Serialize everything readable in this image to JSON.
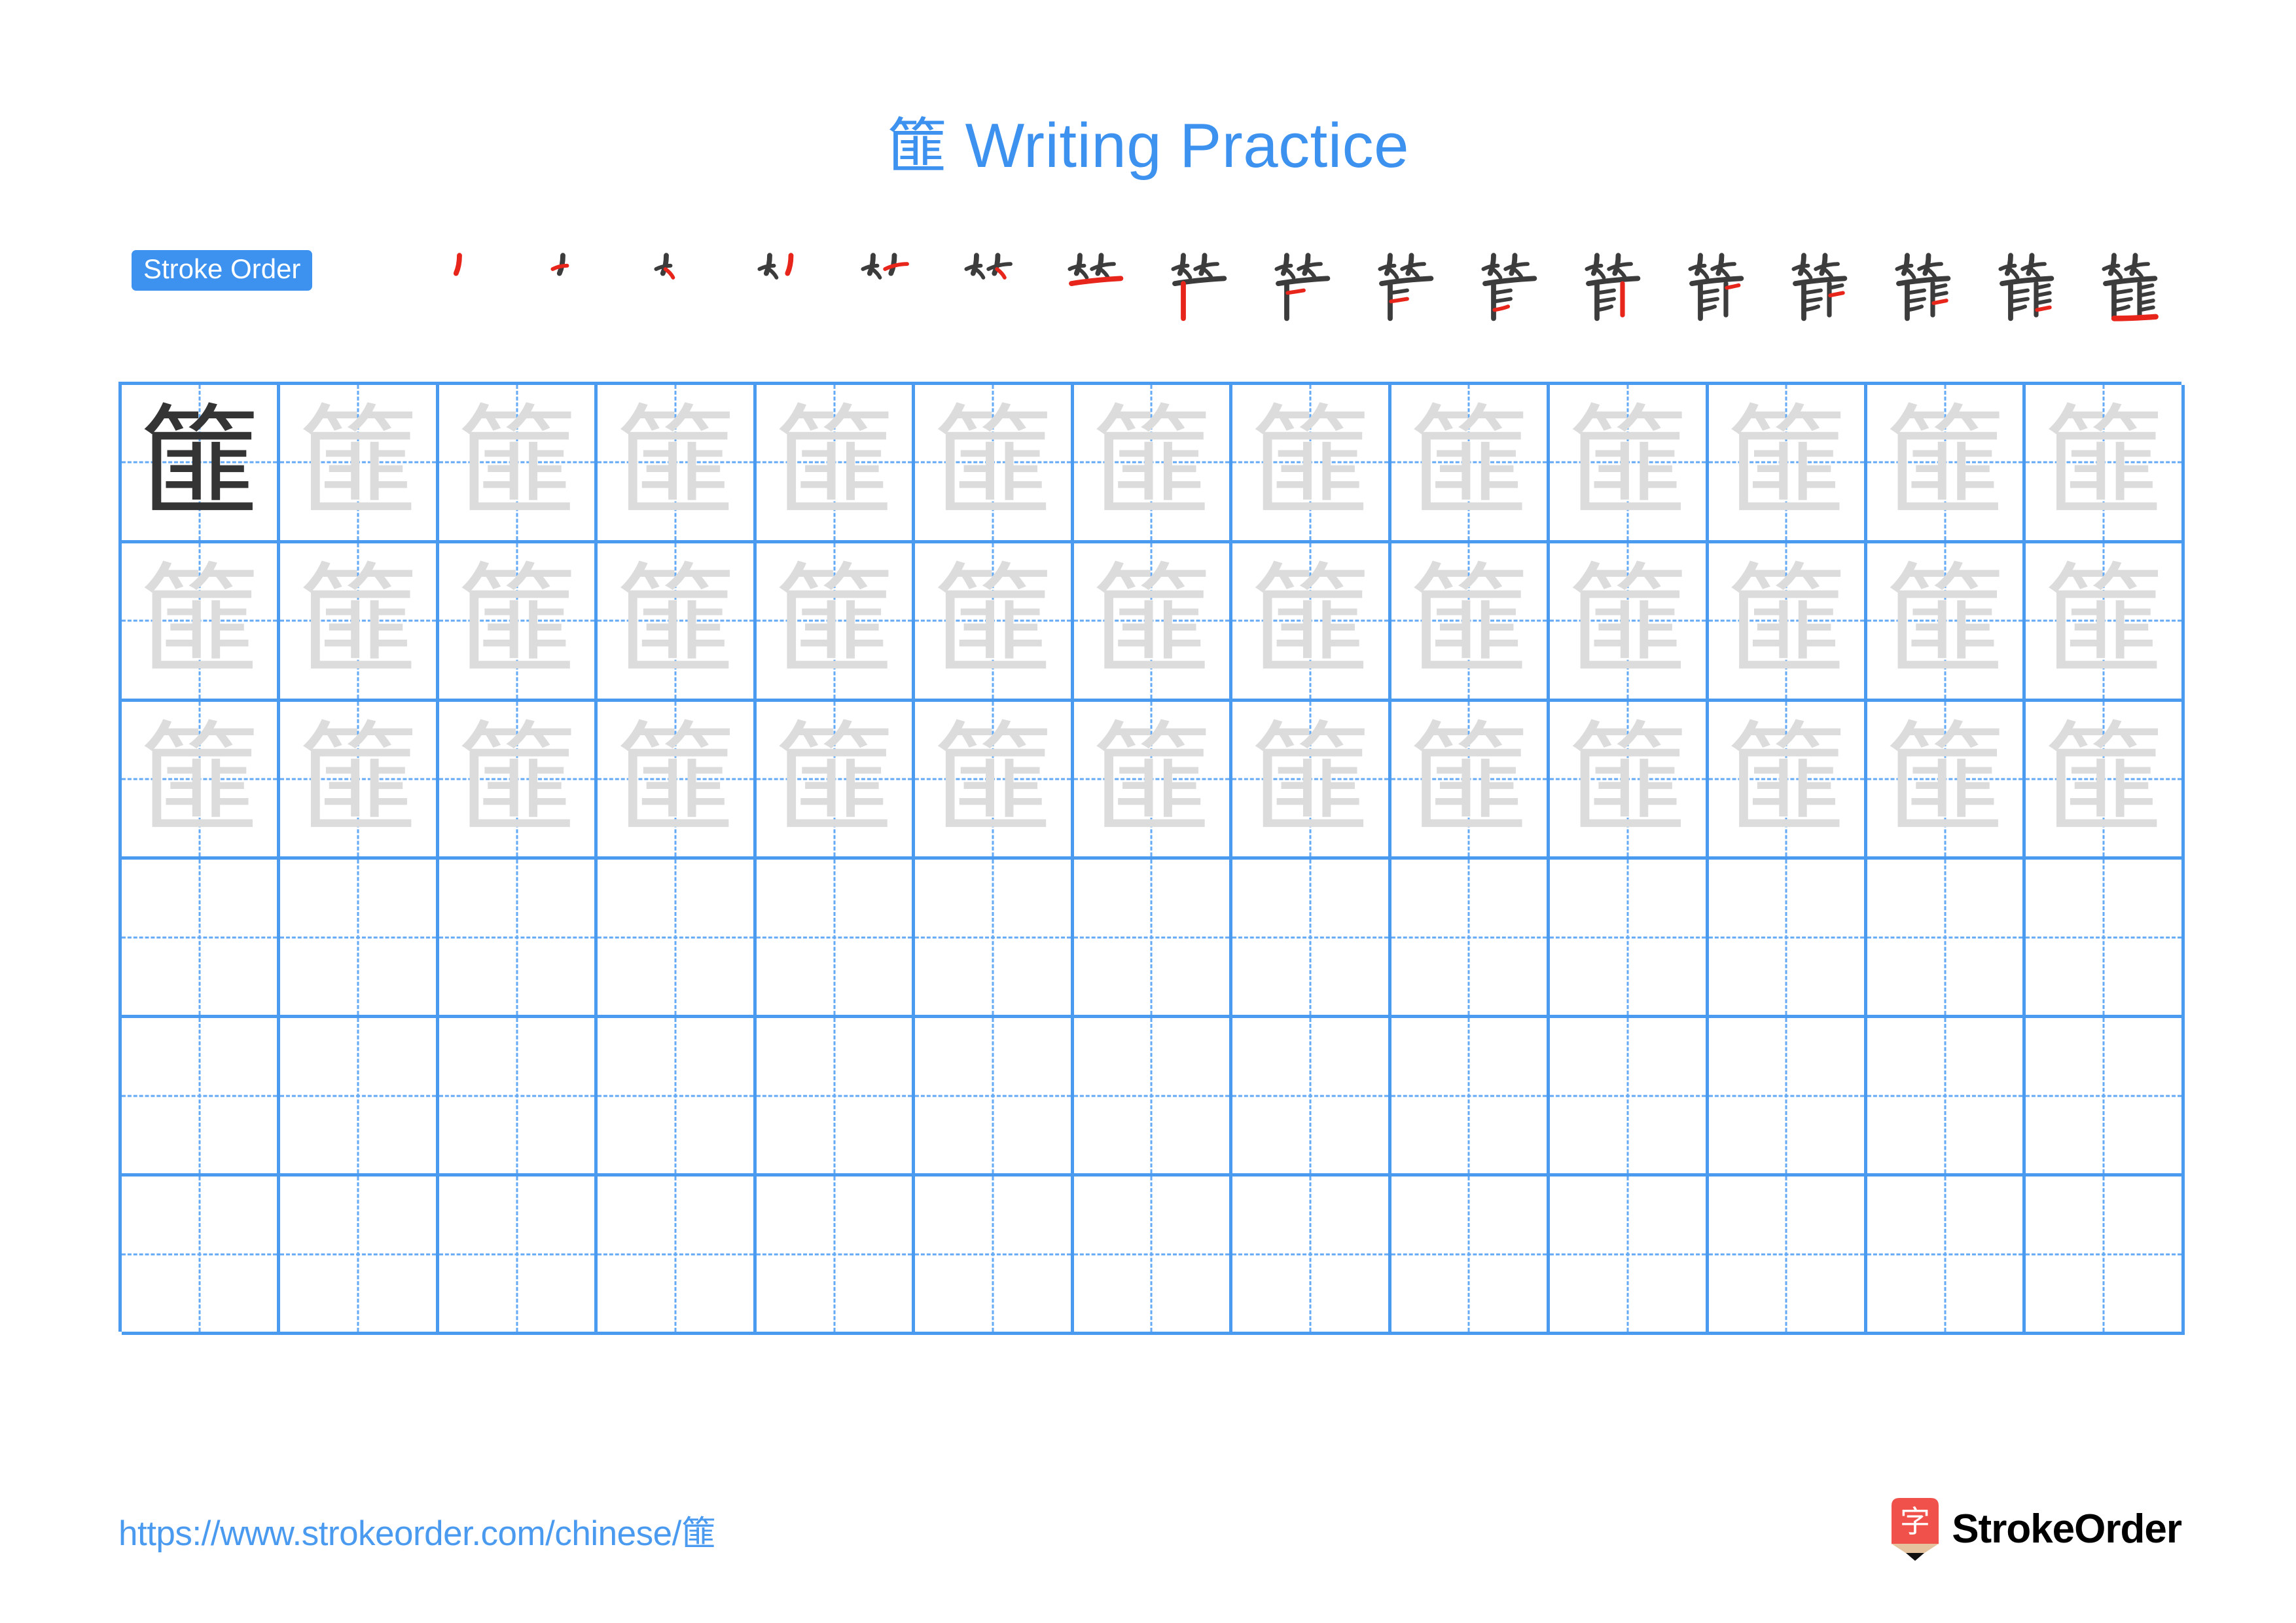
{
  "title": {
    "character": "篚",
    "text": " Writing Practice",
    "color": "#3d92f0"
  },
  "stroke_order": {
    "badge_label": "Stroke Order",
    "badge_bg": "#3d92f0",
    "badge_text_color": "#ffffff",
    "total_strokes": 17,
    "new_stroke_color": "#e8251b",
    "existing_stroke_color": "#3c3c3c",
    "steps": [
      {
        "index": 1,
        "new_stroke": "丿 (left downward)"
      },
      {
        "index": 2,
        "new_stroke": "一 (short horizontal)"
      },
      {
        "index": 3,
        "new_stroke": "丶 (short right dot)"
      },
      {
        "index": 4,
        "new_stroke": "丿 (second left downward)"
      },
      {
        "index": 5,
        "new_stroke": "一 (second short horizontal)"
      },
      {
        "index": 6,
        "new_stroke": "丶 (second short right dot)"
      },
      {
        "index": 7,
        "new_stroke": "一 (horizontal of 匚 top)"
      },
      {
        "index": 8,
        "new_stroke": "丨 (long vertical)"
      },
      {
        "index": 9,
        "new_stroke": "一 (first inner horizontal)"
      },
      {
        "index": 10,
        "new_stroke": "一 (second inner horizontal)"
      },
      {
        "index": 11,
        "new_stroke": "㇀ (rising stroke)"
      },
      {
        "index": 12,
        "new_stroke": "丨 (right vertical)"
      },
      {
        "index": 13,
        "new_stroke": "一 (right first horizontal)"
      },
      {
        "index": 14,
        "new_stroke": "一 (right second horizontal)"
      },
      {
        "index": 15,
        "new_stroke": "一 (right third horizontal)"
      },
      {
        "index": 16,
        "new_stroke": "一 (right fourth horizontal)"
      },
      {
        "index": 17,
        "new_stroke": "乚 (enclosing bottom hook)"
      }
    ]
  },
  "grid": {
    "columns": 13,
    "rows": 6,
    "border_color": "#4a9af0",
    "guide_color": "#64aaf5",
    "model_char_color": "#343434",
    "trace_char_color": "#dcdcdc",
    "character": "篚",
    "rows_data": [
      {
        "row": 1,
        "model_first": true,
        "filled_cells": 13
      },
      {
        "row": 2,
        "model_first": false,
        "filled_cells": 13
      },
      {
        "row": 3,
        "model_first": false,
        "filled_cells": 13
      },
      {
        "row": 4,
        "model_first": false,
        "filled_cells": 0
      },
      {
        "row": 5,
        "model_first": false,
        "filled_cells": 0
      },
      {
        "row": 6,
        "model_first": false,
        "filled_cells": 0
      }
    ]
  },
  "footer": {
    "url_prefix": "https://www.strokeorder.com/chinese/",
    "url_char": "篚",
    "url_color": "#4a9af0",
    "brand_name": "StrokeOrder",
    "logo_char": "字",
    "logo_bg": "#f0514b",
    "logo_tip_color": "#e4c39e",
    "logo_point_color": "#111111"
  }
}
